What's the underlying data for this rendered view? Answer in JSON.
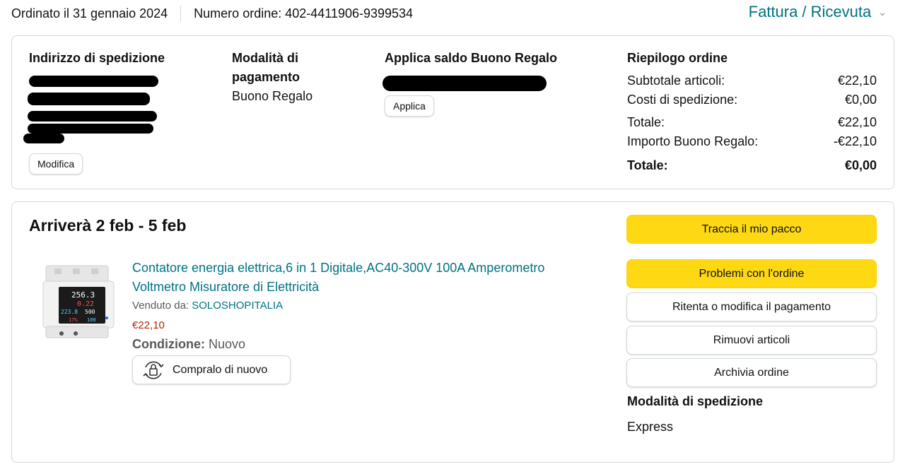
{
  "header": {
    "ordered_on": "Ordinato il 31 gennaio 2024",
    "order_number": "Numero ordine: 402-4411906-9399534",
    "invoice_link": "Fattura / Ricevuta"
  },
  "summary_card": {
    "shipping_address_title": "Indirizzo di spedizione",
    "edit_button": "Modifica",
    "payment_method_title_line1": "Modalità di",
    "payment_method_title_line2": "pagamento",
    "payment_method_value": "Buono Regalo",
    "gift_card_title": "Applica saldo Buono Regalo",
    "apply_button": "Applica",
    "order_summary": {
      "title": "Riepilogo ordine",
      "rows": [
        {
          "label": "Subtotale articoli:",
          "value": "€22,10"
        },
        {
          "label": "Costi di spedizione:",
          "value": "€0,00"
        },
        {
          "label": "Totale:",
          "value": "€22,10"
        },
        {
          "label": "Importo Buono Regalo:",
          "value": "-€22,10"
        },
        {
          "label": "Totale:",
          "value": "€0,00"
        }
      ]
    }
  },
  "shipment_card": {
    "arrival": "Arriverà 2 feb - 5 feb",
    "product": {
      "title": "Contatore energia elettrica,6 in 1 Digitale,AC40-300V 100A Amperometro Voltmetro Misuratore di Elettricità",
      "sold_by_label": "Venduto da:",
      "seller": "SOLOSHOPITALIA",
      "price": "€22,10",
      "condition_label": "Condizione:",
      "condition_value": "Nuovo",
      "buy_again_button": "Compralo di nuovo",
      "display_values": [
        "256.3",
        "0.22",
        "223.8",
        "500",
        "17%",
        "100"
      ]
    },
    "actions": [
      {
        "label": "Traccia il mio pacco",
        "style": "yellow"
      },
      {
        "label": "Problemi con l'ordine",
        "style": "yellow"
      },
      {
        "label": "Ritenta o modifica il pagamento",
        "style": "white"
      },
      {
        "label": "Rimuovi articoli",
        "style": "white"
      },
      {
        "label": "Archivia ordine",
        "style": "white"
      }
    ],
    "shipping_mode_title": "Modalità di spedizione",
    "shipping_mode_value": "Express"
  },
  "colors": {
    "link": "#007185",
    "price": "#b12704",
    "primary_button": "#ffd814",
    "border": "#d5d9d9"
  }
}
